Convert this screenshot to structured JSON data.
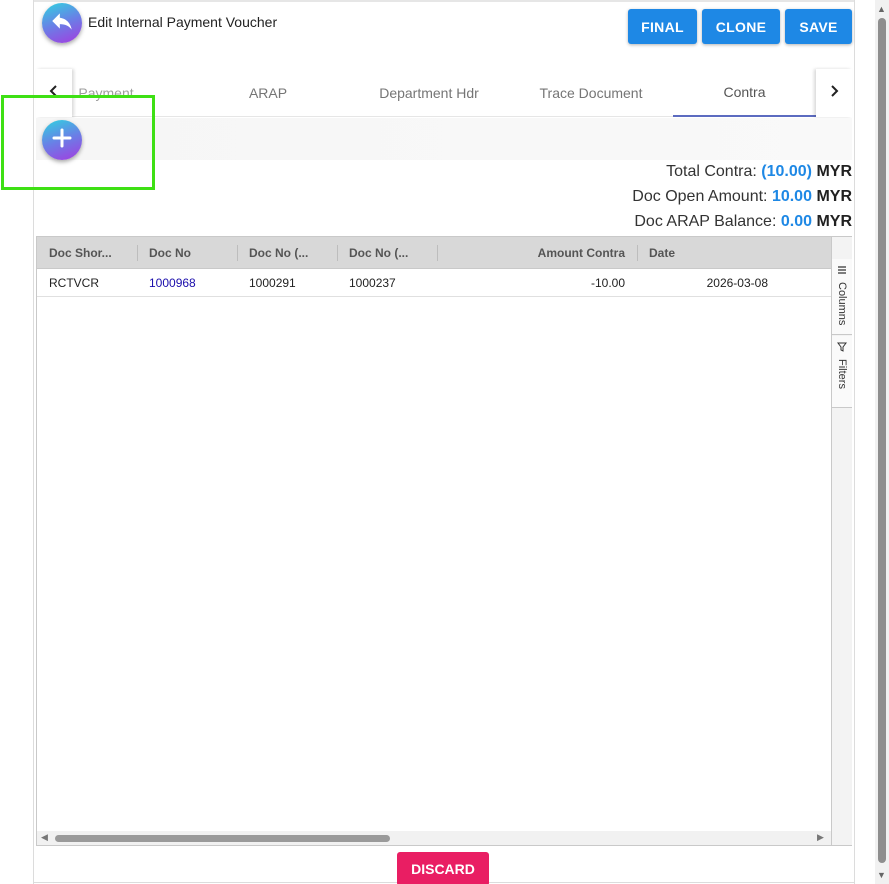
{
  "header": {
    "title": "Edit Internal Payment Voucher",
    "buttons": {
      "final": "FINAL",
      "clone": "CLONE",
      "save": "SAVE"
    }
  },
  "tabs": {
    "items": [
      {
        "label": "Payment"
      },
      {
        "label": "ARAP"
      },
      {
        "label": "Department Hdr"
      },
      {
        "label": "Trace Document"
      },
      {
        "label": "Contra"
      }
    ],
    "active": "Contra",
    "scroll_left": "‹",
    "scroll_right": "›"
  },
  "summary": {
    "total_contra": {
      "label": "Total Contra:",
      "value": "(10.00)",
      "currency": "MYR"
    },
    "doc_open_amount": {
      "label": "Doc Open Amount:",
      "value": "10.00",
      "currency": "MYR"
    },
    "doc_arap_balance": {
      "label": "Doc ARAP Balance:",
      "value": "0.00",
      "currency": "MYR"
    }
  },
  "grid": {
    "columns": [
      "Doc Shor...",
      "Doc No",
      "Doc No (...",
      "Doc No (...",
      "Amount Contra",
      "Date"
    ],
    "rows": [
      {
        "doc_short": "RCTVCR",
        "doc_no": "1000968",
        "doc_no_2": "1000291",
        "doc_no_3": "1000237",
        "amount_contra": "-10.00",
        "date": "2026-03-08"
      }
    ],
    "side_tabs": {
      "columns": "Columns",
      "filters": "Filters"
    }
  },
  "footer": {
    "discard": "DISCARD"
  },
  "colors": {
    "primary": "#1e88e5",
    "discard": "#e91e63",
    "highlight": "#3ee014",
    "tab_indicator": "#5c6bc0"
  },
  "icons": {
    "back": "back-arrow-icon",
    "add": "plus-icon",
    "columns": "columns-icon",
    "filters": "filter-icon"
  }
}
